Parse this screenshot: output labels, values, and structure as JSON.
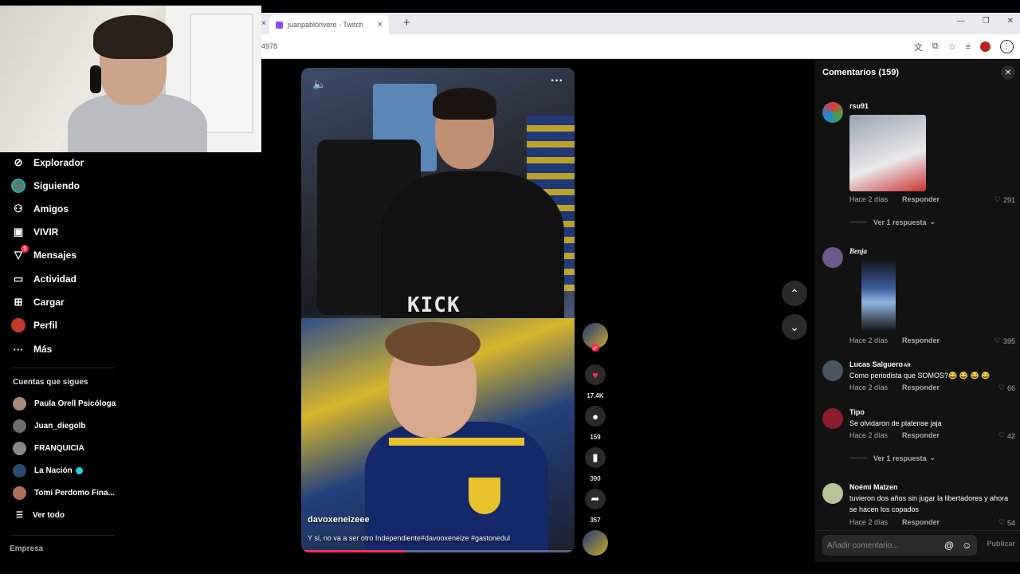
{
  "browser": {
    "tab_title": "juanpablorivero - Twitch",
    "url_fragment": "4978",
    "new_tab": "+",
    "close_glyph": "×"
  },
  "sidebar": {
    "items": [
      {
        "label": "Explorador",
        "icon": "compass-icon",
        "glyph": "⊘"
      },
      {
        "label": "Siguiendo",
        "icon": "following-avatar-icon",
        "glyph": ""
      },
      {
        "label": "Amigos",
        "icon": "friends-icon",
        "glyph": "⚇"
      },
      {
        "label": "VIVIR",
        "icon": "live-tv-icon",
        "glyph": "▣"
      },
      {
        "label": "Mensajes",
        "icon": "messages-icon",
        "glyph": "▽",
        "badge": "1"
      },
      {
        "label": "Actividad",
        "icon": "activity-icon",
        "glyph": "▭"
      },
      {
        "label": "Cargar",
        "icon": "upload-icon",
        "glyph": "⊞"
      },
      {
        "label": "Perfil",
        "icon": "profile-avatar-icon",
        "glyph": ""
      },
      {
        "label": "Más",
        "icon": "more-icon",
        "glyph": "···"
      }
    ],
    "following_title": "Cuentas que sigues",
    "following": [
      {
        "name": "Paula Orell Psicóloga",
        "verified": false
      },
      {
        "name": "Juan_diegolb",
        "verified": false
      },
      {
        "name": "FRANQUICIA",
        "verified": false
      },
      {
        "name": "La Nación",
        "verified": true
      },
      {
        "name": "Tomi Perdomo Fina...",
        "verified": false
      }
    ],
    "see_all": "Ver todo",
    "company": "Empresa"
  },
  "video": {
    "watermark": "KICK",
    "author": "davoxeneizeee",
    "caption": "Y si, no va a ser otro Independiente#davooxeneize #gastonedul",
    "progress": 0.38
  },
  "actions": {
    "likes": "17.4K",
    "comments": "159",
    "saves": "390",
    "shares": "357"
  },
  "comments_panel": {
    "title": "Comentarios",
    "count": "(159)",
    "input_placeholder": "Añadir comentario...",
    "publish": "Publicar",
    "reply_label": "Responder",
    "comments": [
      {
        "user": "rsu91",
        "text": "",
        "time": "Hace 2 días",
        "likes": "291",
        "more": "Ver 1 respuesta"
      },
      {
        "user": "Benja",
        "text": "",
        "time": "Hace 2 días",
        "likes": "395",
        "more": ""
      },
      {
        "user": "Lucas Salguero",
        "user_suffix": "AR",
        "text": "Como periodista que SOMOS?😂 😂 😂 😂",
        "time": "Hace 2 días",
        "likes": "66",
        "more": ""
      },
      {
        "user": "Tipo",
        "text": "Se olvidaron de platense jaja",
        "time": "Hace 2 días",
        "likes": "42",
        "more": "Ver 1 respuesta"
      },
      {
        "user": "Noémi Matzen",
        "text": "tuvieron dos años sin jugar la libertadores y ahora se hacen los copados",
        "time": "Hace 2 días",
        "likes": "54",
        "more": ""
      }
    ]
  },
  "colors": {
    "accent": "#fe2c55",
    "panel": "#121212",
    "background": "#000000"
  }
}
